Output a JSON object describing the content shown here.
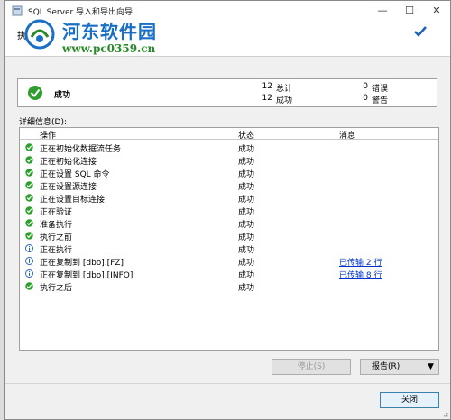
{
  "window": {
    "title": "SQL Server 导入和导出向导",
    "min_glyph": "—",
    "max_glyph": "☐",
    "close_glyph": "✕"
  },
  "header": {
    "heading": "执行成功"
  },
  "watermark": {
    "site_name": "河东软件园",
    "url": "www.pc0359.cn"
  },
  "summary": {
    "status": "成功",
    "total_count": "12",
    "total_label": "总计",
    "success_count": "12",
    "success_label": "成功",
    "error_count": "0",
    "error_label": "错误",
    "warning_count": "0",
    "warning_label": "警告"
  },
  "details": {
    "label": "详细信息(D):",
    "columns": [
      "操作",
      "状态",
      "消息"
    ],
    "rows": [
      {
        "icon": "success-icon",
        "op": "正在初始化数据流任务",
        "status": "成功",
        "message": ""
      },
      {
        "icon": "success-icon",
        "op": "正在初始化连接",
        "status": "成功",
        "message": ""
      },
      {
        "icon": "success-icon",
        "op": "正在设置 SQL 命令",
        "status": "成功",
        "message": ""
      },
      {
        "icon": "success-icon",
        "op": "正在设置源连接",
        "status": "成功",
        "message": ""
      },
      {
        "icon": "success-icon",
        "op": "正在设置目标连接",
        "status": "成功",
        "message": ""
      },
      {
        "icon": "success-icon",
        "op": "正在验证",
        "status": "成功",
        "message": ""
      },
      {
        "icon": "success-icon",
        "op": "准备执行",
        "status": "成功",
        "message": ""
      },
      {
        "icon": "success-icon",
        "op": "执行之前",
        "status": "成功",
        "message": ""
      },
      {
        "icon": "info-icon",
        "op": "正在执行",
        "status": "成功",
        "message": ""
      },
      {
        "icon": "info-icon",
        "op": "正在复制到 [dbo].[FZ]",
        "status": "成功",
        "message": "已传输 2 行"
      },
      {
        "icon": "info-icon",
        "op": "正在复制到 [dbo].[INFO]",
        "status": "成功",
        "message": "已传输 8 行"
      },
      {
        "icon": "success-icon",
        "op": "执行之后",
        "status": "成功",
        "message": ""
      }
    ]
  },
  "buttons": {
    "stop": "停止(S)",
    "report": "报告(R)",
    "report_arrow": "▼",
    "close": "关闭"
  },
  "colors": {
    "success_green": "#2e9e2e",
    "info_blue": "#1e5fb8",
    "link_blue": "#0033cc",
    "watermark_blue": "#1a6fc4",
    "watermark_green": "#2a8a2a"
  }
}
